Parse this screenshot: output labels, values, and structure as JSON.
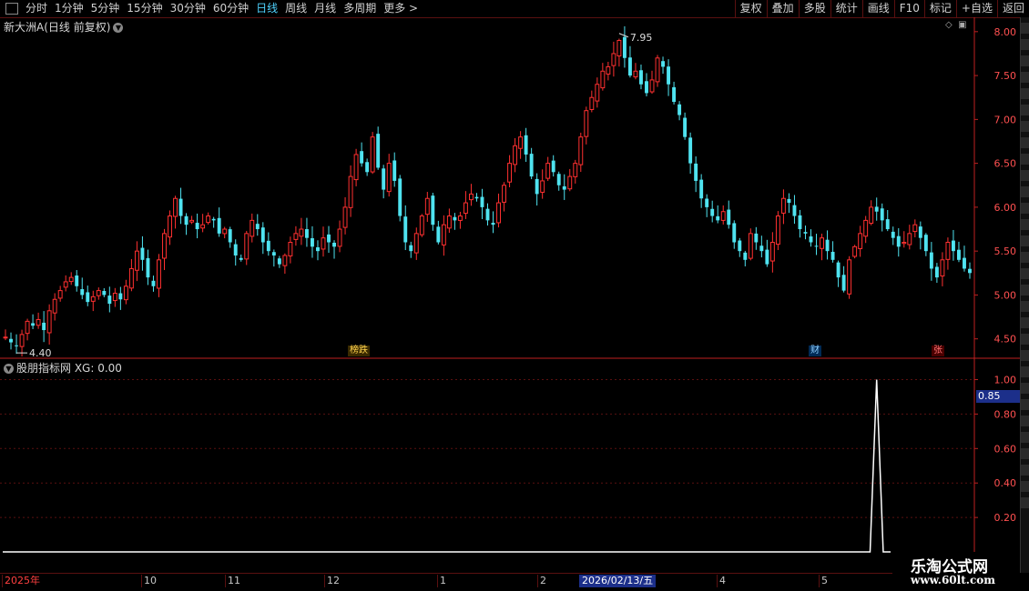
{
  "toolbar": {
    "periods": [
      "分时",
      "1分钟",
      "5分钟",
      "15分钟",
      "30分钟",
      "60分钟",
      "日线",
      "周线",
      "月线",
      "多周期",
      "更多 >"
    ],
    "active": "日线",
    "buttons": [
      "复权",
      "叠加",
      "多股",
      "统计",
      "画线",
      "F10",
      "标记",
      "+自选",
      "返回"
    ]
  },
  "main_title": "新大洲A(日线 前复权)",
  "indicator_title": "股朋指标网 XG: 0.00",
  "badges": {
    "lhb": "榜跌",
    "cai": "财",
    "zhang": "张"
  },
  "current_value": "0.85",
  "date_axis": {
    "labels": [
      "2025年",
      "10",
      "11",
      "12",
      "1",
      "2",
      "4",
      "5"
    ],
    "highlight": "2026/02/13/五"
  },
  "watermark": {
    "line1": "乐淘公式网",
    "line2": "www.60lt.com"
  },
  "colors": {
    "up": "#ff3030",
    "down": "#4fe3f0",
    "grid": "#5a1010",
    "axis": "#c02020",
    "signal": "#ffffff"
  },
  "chart_data": [
    {
      "type": "candlestick",
      "yaxis_ticks": [
        "8.00",
        "7.50",
        "7.00",
        "6.50",
        "6.00",
        "5.50",
        "5.00",
        "4.50"
      ],
      "ylim": [
        4.3,
        8.05
      ],
      "high_label": "7.95",
      "low_label": "4.40",
      "closes": [
        4.52,
        4.46,
        4.42,
        4.55,
        4.7,
        4.65,
        4.72,
        4.6,
        4.82,
        4.95,
        5.05,
        5.15,
        5.2,
        5.1,
        5.0,
        4.92,
        4.98,
        5.05,
        5.0,
        4.9,
        5.02,
        4.95,
        5.1,
        5.3,
        5.5,
        5.4,
        5.2,
        5.1,
        5.4,
        5.7,
        5.9,
        6.1,
        5.9,
        5.8,
        5.85,
        5.75,
        5.8,
        5.9,
        5.85,
        5.7,
        5.75,
        5.6,
        5.45,
        5.4,
        5.7,
        5.85,
        5.75,
        5.6,
        5.5,
        5.45,
        5.35,
        5.45,
        5.6,
        5.7,
        5.75,
        5.65,
        5.55,
        5.5,
        5.65,
        5.6,
        5.55,
        5.75,
        6.0,
        6.35,
        6.6,
        6.5,
        6.4,
        6.8,
        6.45,
        6.2,
        6.5,
        6.3,
        5.9,
        5.6,
        5.5,
        5.7,
        5.9,
        6.1,
        5.8,
        5.6,
        5.8,
        5.9,
        5.85,
        5.9,
        6.05,
        6.15,
        6.1,
        6.0,
        5.85,
        5.8,
        6.05,
        6.25,
        6.5,
        6.7,
        6.8,
        6.6,
        6.35,
        6.15,
        6.3,
        6.5,
        6.4,
        6.25,
        6.2,
        6.35,
        6.5,
        6.8,
        7.1,
        7.25,
        7.4,
        7.55,
        7.6,
        7.75,
        7.9,
        7.7,
        7.5,
        7.55,
        7.4,
        7.3,
        7.45,
        7.7,
        7.6,
        7.4,
        7.2,
        7.05,
        6.8,
        6.5,
        6.3,
        6.1,
        6.0,
        5.9,
        5.85,
        5.95,
        5.8,
        5.6,
        5.5,
        5.4,
        5.7,
        5.6,
        5.5,
        5.35,
        5.6,
        5.9,
        6.1,
        6.05,
        5.9,
        5.75,
        5.7,
        5.6,
        5.55,
        5.65,
        5.5,
        5.4,
        5.2,
        5.05,
        5.4,
        5.55,
        5.7,
        5.85,
        6.0,
        5.95,
        5.85,
        5.75,
        5.65,
        5.55,
        5.6,
        5.7,
        5.8,
        5.65,
        5.5,
        5.3,
        5.2,
        5.4,
        5.6,
        5.5,
        5.4,
        5.3,
        5.25
      ]
    },
    {
      "type": "line",
      "series": [
        {
          "name": "XG"
        }
      ],
      "yaxis_ticks": [
        "1.00",
        "0.80",
        "0.60",
        "0.40",
        "0.20"
      ],
      "ylim": [
        -0.1,
        1.05
      ],
      "signal_day_index": 159,
      "signal_value": 1.0
    }
  ]
}
